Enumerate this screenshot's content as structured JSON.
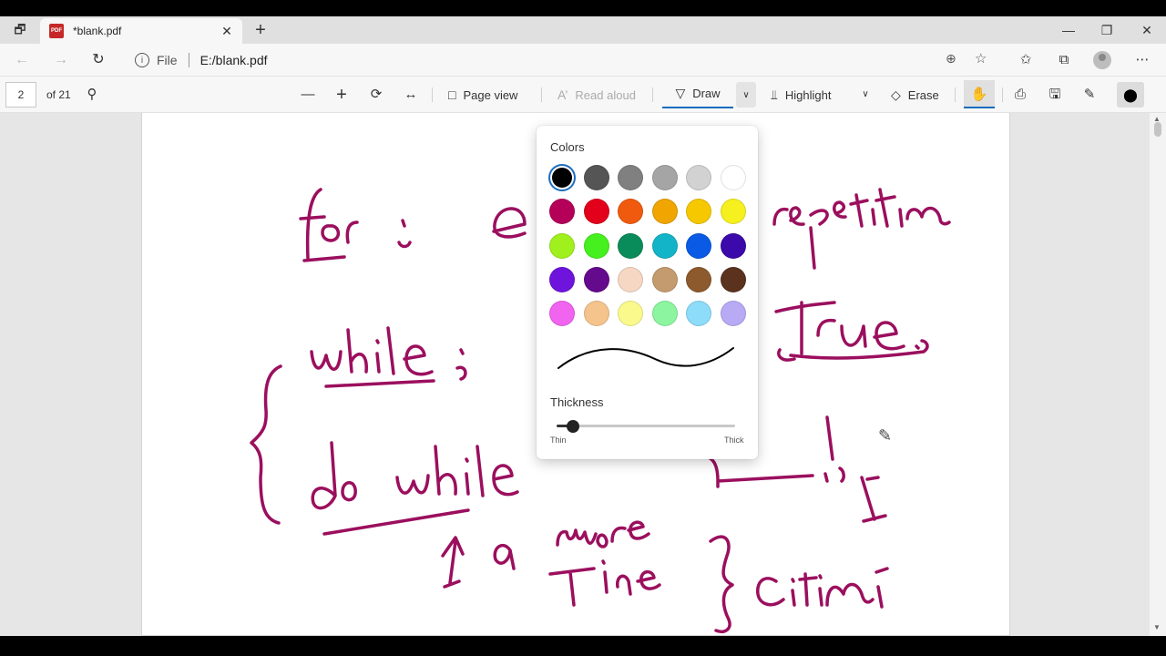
{
  "tab": {
    "title": "*blank.pdf",
    "favicon": "PDF"
  },
  "address": {
    "scheme": "File",
    "url": "E:/blank.pdf"
  },
  "pdf_toolbar": {
    "page_number": "2",
    "page_count": "of 21",
    "page_view": "Page view",
    "read_aloud": "Read aloud",
    "draw": "Draw",
    "highlight": "Highlight",
    "erase": "Erase"
  },
  "draw_flyout": {
    "colors_title": "Colors",
    "thickness_title": "Thickness",
    "thin_label": "Thin",
    "thick_label": "Thick",
    "thickness_value": 0.09,
    "selected_color": "#000000",
    "colors": [
      "#000000",
      "#555555",
      "#808080",
      "#a5a5a5",
      "#d2d2d2",
      "#ffffff",
      "#b5005a",
      "#e3001b",
      "#f05a0f",
      "#f0a500",
      "#f5c800",
      "#f5f01e",
      "#a0f01e",
      "#46f01e",
      "#0a8c5a",
      "#14b4c8",
      "#0a5ae6",
      "#3c0aaa",
      "#6e14dc",
      "#640a8c",
      "#f5d7c3",
      "#c39b6e",
      "#8c5a2d",
      "#5a321e",
      "#f064f0",
      "#f5c38c",
      "#fafa8c",
      "#8cf5a0",
      "#8cdcfa",
      "#b9aaf5"
    ]
  },
  "ink_color": "#9b0f5e"
}
